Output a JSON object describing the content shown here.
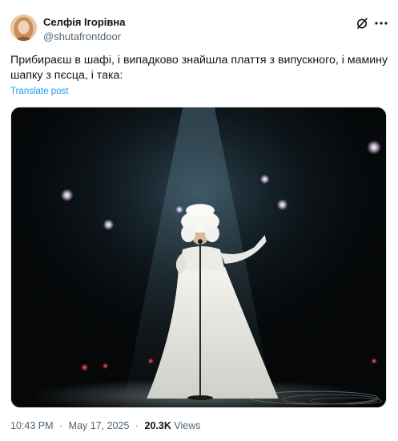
{
  "author": {
    "display_name": "Селфія Ігорівна",
    "handle": "@shutafrontdoor"
  },
  "tweet": {
    "text": "Прибираєш в шафі, і випадково знайшла плаття з випускного, і мамину шапку з пєсца, і така:",
    "translate_label": "Translate post"
  },
  "meta": {
    "time": "10:43 PM",
    "separator": "·",
    "date": "May 17, 2025",
    "views_count": "20.3K",
    "views_label": "Views"
  },
  "icons": {
    "grok": "grok-icon",
    "more": "more-horizontal-icon"
  },
  "colors": {
    "link": "#1d9bf0",
    "secondary_text": "#536471",
    "primary_text": "#0f1419"
  }
}
